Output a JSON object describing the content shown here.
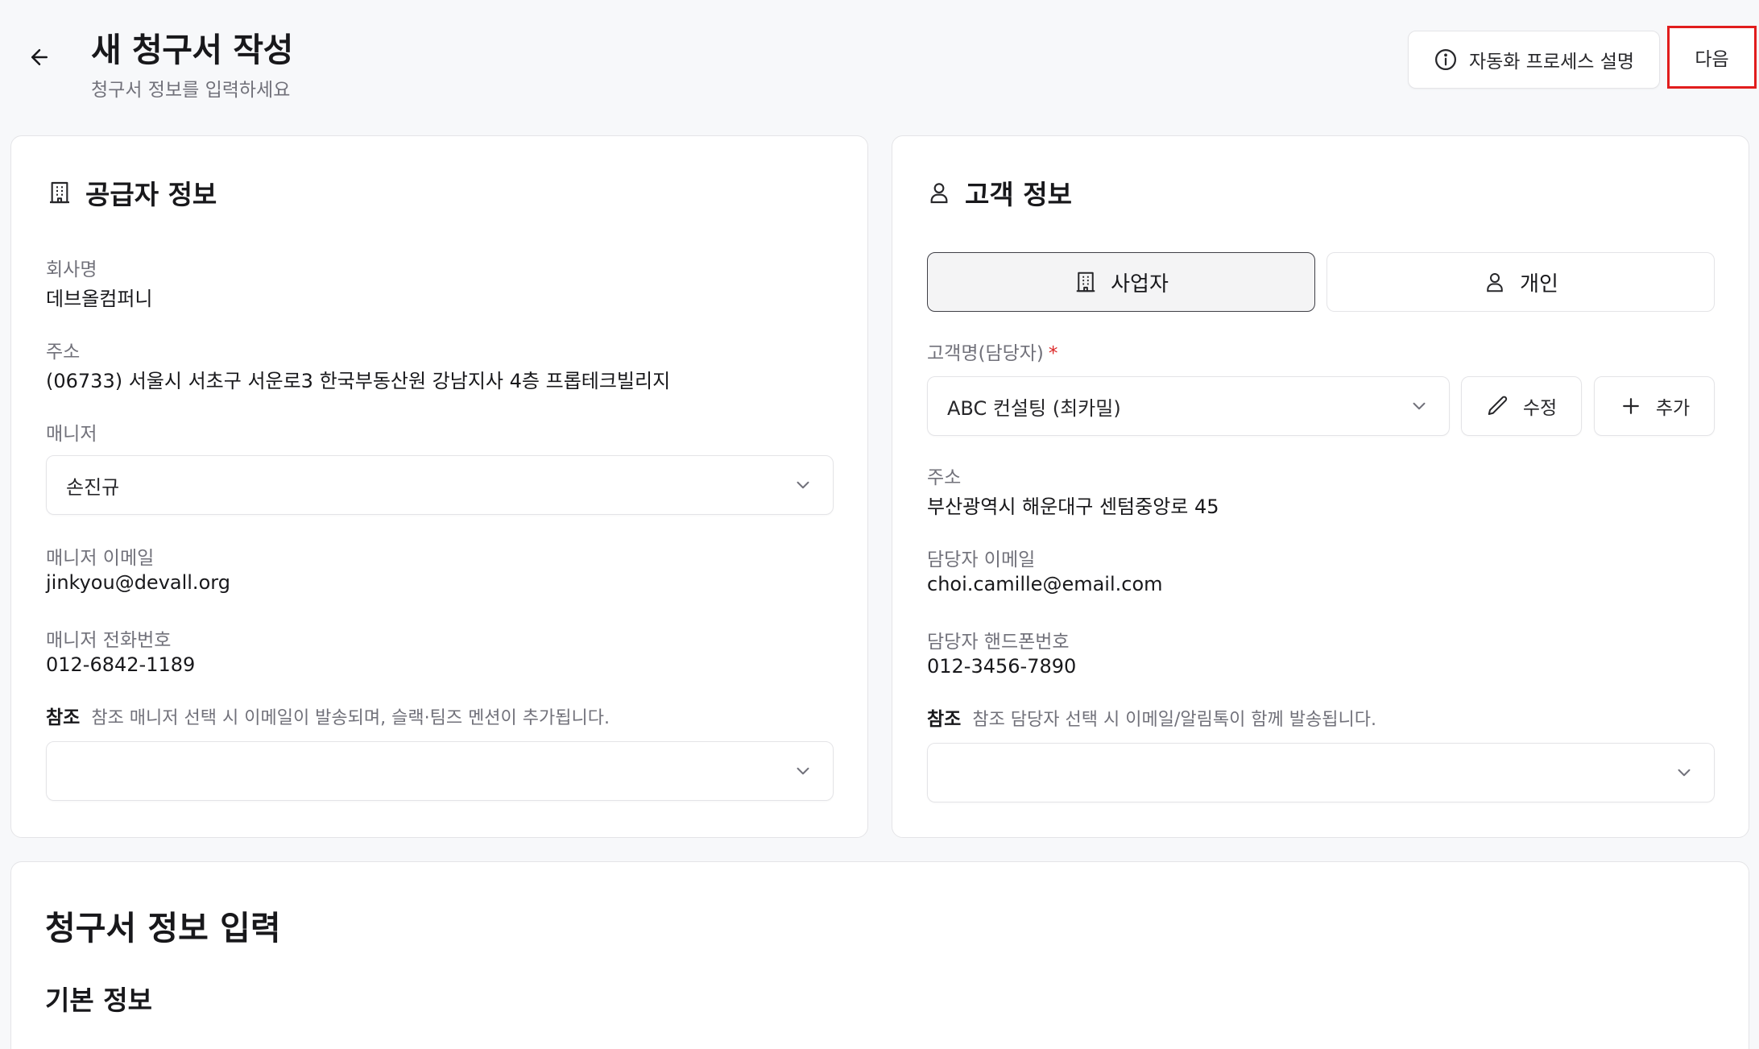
{
  "header": {
    "title": "새 청구서 작성",
    "subtitle": "청구서 정보를 입력하세요",
    "process_button": "자동화 프로세스 설명",
    "next_button": "다음"
  },
  "supplier": {
    "title": "공급자 정보",
    "company_label": "회사명",
    "company_value": "데브올컴퍼니",
    "address_label": "주소",
    "address_value": "(06733) 서울시 서초구 서운로3 한국부동산원 강남지사 4층 프롭테크빌리지",
    "manager_label": "매니저",
    "manager_value": "손진규",
    "manager_email_label": "매니저 이메일",
    "manager_email_value": "jinkyou@devall.org",
    "manager_phone_label": "매니저 전화번호",
    "manager_phone_value": "012-6842-1189",
    "reference_label": "참조",
    "reference_note": "참조 매니저 선택 시 이메일이 발송되며, 슬랙·팀즈 멘션이 추가됩니다.",
    "reference_value": ""
  },
  "customer": {
    "title": "고객 정보",
    "type_business": "사업자",
    "type_individual": "개인",
    "selected_type": "사업자",
    "customer_label": "고객명(담당자)",
    "required_mark": "*",
    "customer_value": "ABC 컨설팅 (최카밀)",
    "edit_button": "수정",
    "add_button": "추가",
    "address_label": "주소",
    "address_value": "부산광역시 해운대구 센텀중앙로 45",
    "email_label": "담당자 이메일",
    "email_value": "choi.camille@email.com",
    "phone_label": "담당자 핸드폰번호",
    "phone_value": "012-3456-7890",
    "reference_label": "참조",
    "reference_note": "참조 담당자 선택 시 이메일/알림톡이 함께 발송됩니다.",
    "reference_value": ""
  },
  "invoice": {
    "title": "청구서 정보 입력",
    "section_basic": "기본 정보"
  },
  "colors": {
    "highlight_border": "#e11d1d",
    "required": "#dc2626",
    "label_gray": "#71717a"
  },
  "icons": {
    "back": "arrow-left-icon",
    "info": "info-icon",
    "building": "building-icon",
    "user": "user-icon",
    "chevron": "chevron-down-icon",
    "pencil": "pencil-icon",
    "plus": "plus-icon"
  }
}
